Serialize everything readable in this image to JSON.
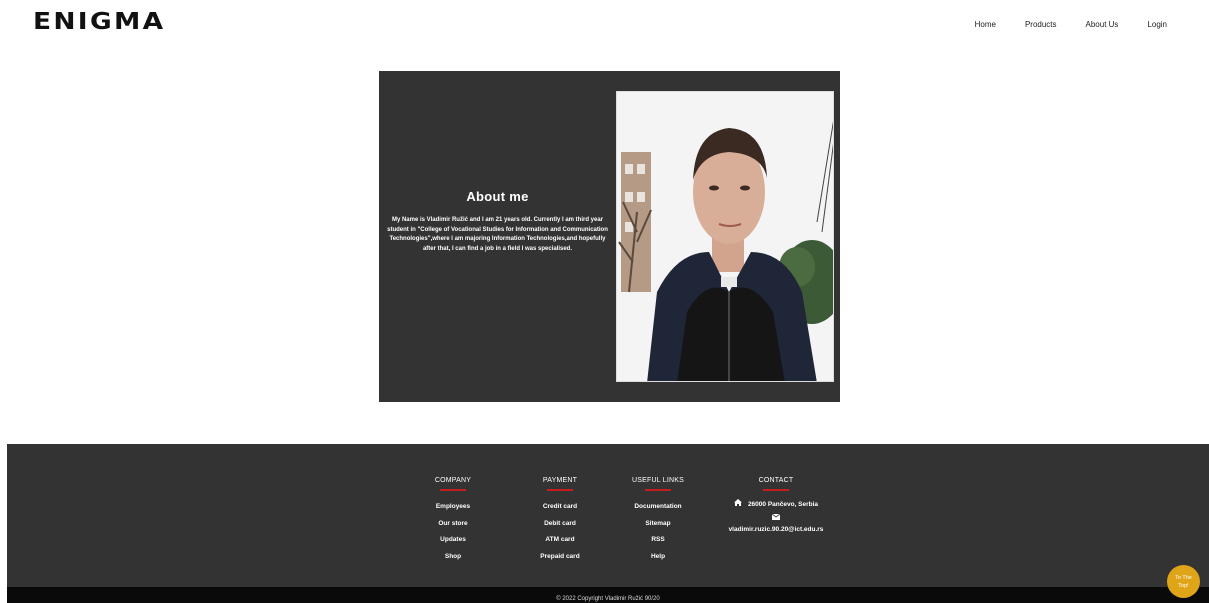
{
  "header": {
    "logo": "ENIGMA",
    "nav": [
      "Home",
      "Products",
      "About Us",
      "Login"
    ]
  },
  "about": {
    "title": "About me",
    "body": "My Name is Vladimir Ružić and I am 21 years old. Currently I am third year student in \"College of Vocational Studies for Information and Communication Technologies\",where I am majoring Information Technologies,and hopefully after that, I can find a job in a field I was specialised."
  },
  "footer": {
    "company": {
      "title": "COMPANY",
      "links": [
        "Employees",
        "Our store",
        "Updates",
        "Shop"
      ]
    },
    "payment": {
      "title": "PAYMENT",
      "links": [
        "Credit card",
        "Debit card",
        "ATM card",
        "Prepaid card"
      ]
    },
    "useful": {
      "title": "USEFUL LINKS",
      "links": [
        "Documentation",
        "Sitemap",
        "RSS",
        "Help"
      ]
    },
    "contact": {
      "title": "CONTACT",
      "address": "26000 Pančevo, Serbia",
      "email": "vladimir.ruzic.90.20@ict.edu.rs"
    },
    "copyright": "© 2022 Copyright Vladimir Ružić 90/20"
  },
  "to_top": {
    "line1": "To The",
    "line2": "Top!"
  },
  "icons": {
    "address": "home-icon",
    "email": "envelope-icon"
  },
  "colors": {
    "dark": "#333333",
    "accent_bar": "#c41e1e",
    "to_top": "#e0a419"
  }
}
